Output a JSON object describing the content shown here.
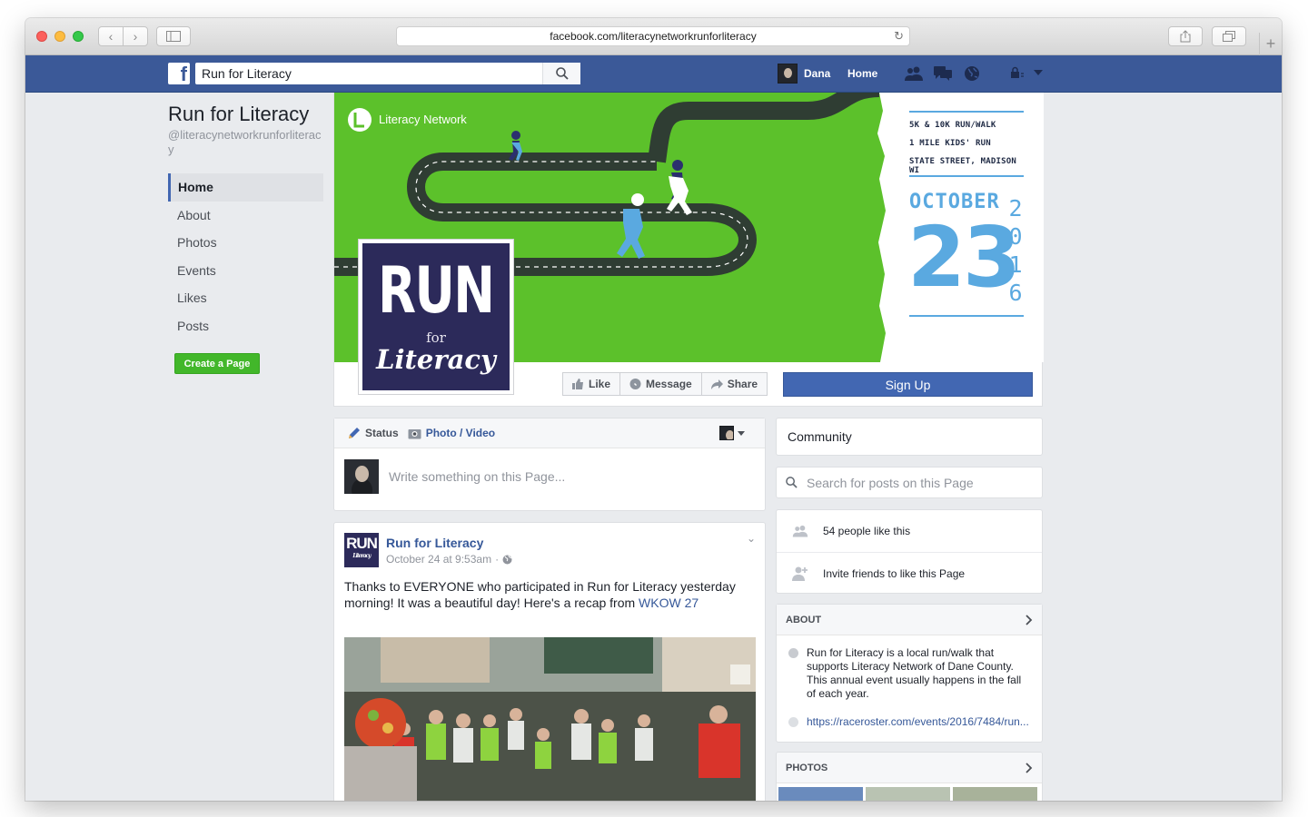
{
  "browser": {
    "url": "facebook.com/literacynetworkrunforliteracy"
  },
  "topbar": {
    "search_value": "Run for Literacy",
    "user_name": "Dana",
    "home_label": "Home"
  },
  "page": {
    "title": "Run for Literacy",
    "handle": "@literacynetworkrunforliteracy",
    "nav": [
      "Home",
      "About",
      "Photos",
      "Events",
      "Likes",
      "Posts"
    ],
    "create_page_label": "Create a Page"
  },
  "cover": {
    "brand": "Literacy Network",
    "info_lines": [
      "5K & 10K RUN/WALK",
      "1 MILE KIDS' RUN",
      "STATE STREET, MADISON WI"
    ],
    "month": "OCTOBER",
    "day": "23",
    "year_digits": [
      "2",
      "0",
      "1",
      "6"
    ],
    "profile_run": "RUN",
    "profile_for": "for",
    "profile_literacy": "Literacy",
    "bg_color": "#5cc12b",
    "accent_color": "#5aa9e0"
  },
  "actions": {
    "like": "Like",
    "message": "Message",
    "share": "Share",
    "signup": "Sign Up"
  },
  "composer": {
    "status_tab": "Status",
    "photo_tab": "Photo / Video",
    "placeholder": "Write something on this Page..."
  },
  "post": {
    "author": "Run for Literacy",
    "timestamp": "October 24 at 9:53am",
    "avatar_run": "RUN",
    "avatar_literacy": "Literacy",
    "text": "Thanks to EVERYONE who participated in Run for Literacy yesterday morning! It was a beautiful day! Here's a recap from ",
    "link": "WKOW 27"
  },
  "sidebar": {
    "community_title": "Community",
    "search_placeholder": "Search for posts on this Page",
    "likes_count": "54 people like this",
    "invite_text": "Invite friends to like this Page",
    "about_header": "ABOUT",
    "about_text": "Run for Literacy is a local run/walk that supports Literacy Network of Dane County. This annual event usually happens in the fall of each year.",
    "about_url": "https://raceroster.com/events/2016/7484/run...",
    "photos_header": "PHOTOS"
  }
}
